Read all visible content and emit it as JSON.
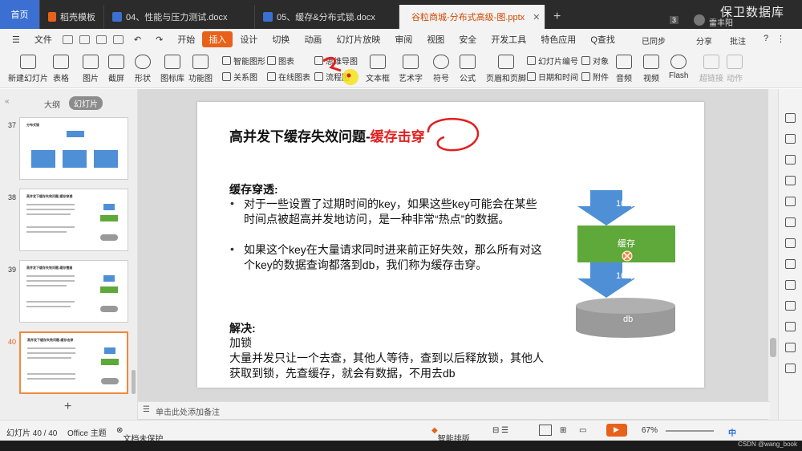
{
  "tabs": [
    {
      "label": "首页",
      "kind": "home"
    },
    {
      "label": "稻壳模板",
      "color": "#e8611a"
    },
    {
      "label": "04、性能与压力测试.docx",
      "color": "#3b6fd1"
    },
    {
      "label": "05、缓存&分布式锁.docx",
      "color": "#3b6fd1"
    },
    {
      "label": "谷粒商城-分布式高级-图.pptx",
      "color": "#e8611a"
    }
  ],
  "tab_add": "+",
  "tab_count": "3",
  "user": "雷丰阳",
  "watermark": "保卫数据库",
  "menu": {
    "file": "文件",
    "items": [
      "开始",
      "插入",
      "设计",
      "切换",
      "动画",
      "幻灯片放映",
      "审阅",
      "视图",
      "安全",
      "开发工具",
      "特色应用"
    ],
    "active": "插入",
    "search": "Q查找",
    "sync": "已同步",
    "share": "分享",
    "comment": "批注"
  },
  "ribbon": {
    "new_slide": "新建幻灯片",
    "table": "表格",
    "image": "图片",
    "screenshot": "截屏",
    "shape": "形状",
    "icon_lib": "图标库",
    "func_chart": "功能图",
    "smart_shape": "智能图形",
    "chart": "图表",
    "mindmap": "思维导图",
    "relation": "关系图",
    "online_chart": "在线图表",
    "flowchart": "流程图",
    "textbox": "文本框",
    "art_text": "艺术字",
    "symbol": "符号",
    "formula": "公式",
    "header_footer": "页眉和页脚",
    "slide_num": "幻灯片编号",
    "object": "对象",
    "datetime": "日期和时间",
    "attachment": "附件",
    "audio": "音频",
    "video": "视频",
    "flash": "Flash",
    "hyperlink": "超链接",
    "action": "动作"
  },
  "panel": {
    "outline_tab": "大纲",
    "slides_tab": "幻灯片",
    "slide_numbers": [
      "37",
      "38",
      "39",
      "40"
    ],
    "thumb37_title": "分布式锁",
    "thumb38_title": "高并发下缓存失效问题-缓存穿透",
    "thumb39_title": "高并发下缓存失效问题-缓存雪崩",
    "thumb40_title": "高并发下缓存失效问题-缓存击穿"
  },
  "slide": {
    "title_main": "高并发下缓存失效问题-",
    "title_red": "缓存击穿",
    "section1": "缓存穿透:",
    "bullet1": "对于一些设置了过期时间的key，如果这些key可能会在某些时间点被超高并发地访问，是一种非常“热点”的数据。",
    "bullet2": "如果这个key在大量请求同时进来前正好失效，那么所有对这个key的数据查询都落到db，我们称为缓存击穿。",
    "section2": "解决:",
    "sol1": "加锁",
    "sol2": "大量并发只让一个去查，其他人等待，查到以后释放锁，其他人获取到锁，先查缓存，就会有数据，不用去db",
    "arrow_top": "100万",
    "cache_box": "缓存",
    "arrow_bottom": "100万",
    "db": "db"
  },
  "notes": "单击此处添加备注",
  "status": {
    "slide_count": "幻灯片 40 / 40",
    "theme": "Office 主题",
    "protect": "文档未保护",
    "smart_layout": "智能排版",
    "zoom": "67%",
    "ime": "中"
  },
  "csdn": "CSDN @wang_book",
  "colors": {
    "accent": "#e8611a",
    "arrow_blue": "#4e8fd6",
    "cache_green": "#5fa83a",
    "db_gray": "#9a9a9a",
    "title_red": "#e02020"
  }
}
